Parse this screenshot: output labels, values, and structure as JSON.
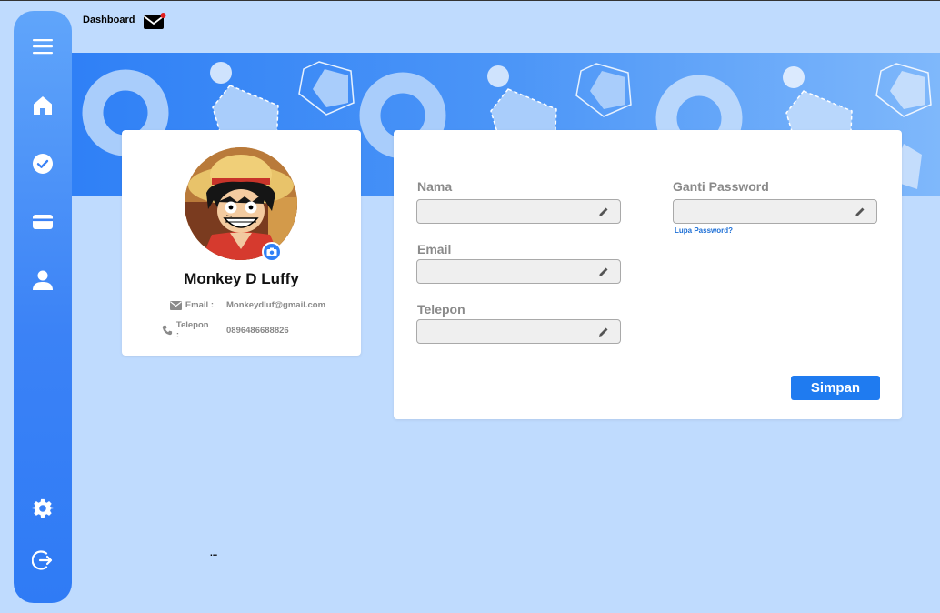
{
  "header": {
    "title": "Dashboard",
    "mail_icon": "mail-icon",
    "notification_color": "#e11d1d"
  },
  "sidebar": {
    "items": [
      {
        "name": "menu",
        "icon": "hamburger-menu-icon"
      },
      {
        "name": "home",
        "icon": "home-icon"
      },
      {
        "name": "tasks",
        "icon": "check-circle-icon"
      },
      {
        "name": "payment",
        "icon": "card-icon"
      },
      {
        "name": "profile",
        "icon": "user-icon"
      },
      {
        "name": "settings",
        "icon": "gear-icon"
      },
      {
        "name": "logout",
        "icon": "logout-icon"
      }
    ]
  },
  "profile": {
    "name": "Monkey D Luffy",
    "email_label": "Email :",
    "email_value": "Monkeydluf@gmail.com",
    "phone_label": "Telepon :",
    "phone_value": "0896486688826",
    "avatar_icon": "avatar-image",
    "camera_icon": "camera-icon"
  },
  "form": {
    "nama_label": "Nama",
    "nama_value": "",
    "email_label": "Email",
    "email_value": "",
    "telepon_label": "Telepon",
    "telepon_value": "",
    "password_label": "Ganti Password",
    "password_value": "",
    "forgot_link": "Lupa Password?",
    "save_label": "Simpan"
  },
  "footer": {
    "ellipsis": "..."
  },
  "colors": {
    "background": "#bfdbfe",
    "accent": "#1f7bf0",
    "sidebar_top": "#60a5fa",
    "sidebar_bottom": "#2f7bf5"
  }
}
